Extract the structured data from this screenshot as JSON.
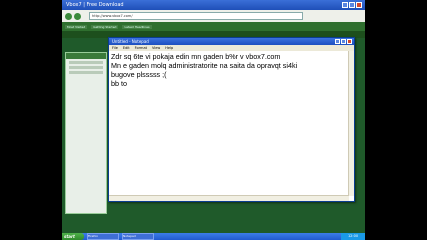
{
  "browser": {
    "title": "Vbox7 | Free Download",
    "address": "http://www.vbox7.com/",
    "bookmarks": [
      "Most Visited",
      "Getting Started",
      "Latest Headlines"
    ]
  },
  "notepad": {
    "title": "Untitled - Notepad",
    "menu": [
      "File",
      "Edit",
      "Format",
      "View",
      "Help"
    ],
    "lines": [
      "Zdr sq 6te vi pokaja edin mn gaden b%r v vbox7.com",
      "Mn e gaden molq administratorite na saita da opravqt si4ki",
      "bugove plsssss ;(",
      "bb to"
    ]
  },
  "taskbar": {
    "start_label": "start",
    "tasks": [
      "Firefox",
      "Notepad"
    ],
    "clock": "12:00"
  }
}
